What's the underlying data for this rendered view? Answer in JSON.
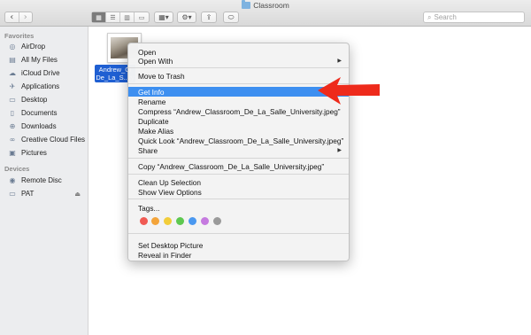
{
  "window": {
    "title": "Classroom"
  },
  "toolbar": {
    "back_glyph": "‹",
    "forward_glyph": "›",
    "view_modes": [
      {
        "icon": "icon-view-grid",
        "glyph": "▦",
        "active": true
      },
      {
        "icon": "list-view-icon",
        "glyph": "☰",
        "active": false
      },
      {
        "icon": "column-view-icon",
        "glyph": "▥",
        "active": false
      },
      {
        "icon": "cover-flow-icon",
        "glyph": "▭",
        "active": false
      }
    ],
    "arrange_glyph": "▦▾",
    "action_glyph": "⚙▾",
    "share_glyph": "⇪",
    "tags_glyph": "⬭",
    "search": {
      "placeholder": "Search",
      "icon": "search-icon"
    }
  },
  "sidebar": {
    "favorites_header": "Favorites",
    "favorites": [
      {
        "label": "AirDrop",
        "icon": "airdrop-icon",
        "glyph": "◎"
      },
      {
        "label": "All My Files",
        "icon": "all-files-icon",
        "glyph": "▤"
      },
      {
        "label": "iCloud Drive",
        "icon": "cloud-icon",
        "glyph": "☁"
      },
      {
        "label": "Applications",
        "icon": "applications-icon",
        "glyph": "✈"
      },
      {
        "label": "Desktop",
        "icon": "desktop-icon",
        "glyph": "▭"
      },
      {
        "label": "Documents",
        "icon": "documents-icon",
        "glyph": "▯"
      },
      {
        "label": "Downloads",
        "icon": "downloads-icon",
        "glyph": "⊕"
      },
      {
        "label": "Creative Cloud Files",
        "icon": "creative-cloud-icon",
        "glyph": "∞"
      },
      {
        "label": "Pictures",
        "icon": "pictures-icon",
        "glyph": "▣"
      }
    ],
    "devices_header": "Devices",
    "devices": [
      {
        "label": "Remote Disc",
        "icon": "disc-icon",
        "glyph": "◉"
      },
      {
        "label": "PAT",
        "icon": "drive-icon",
        "glyph": "▭",
        "eject": "⏏"
      }
    ]
  },
  "file": {
    "label_line1": "Andrew_Cl",
    "label_line2": "De_La_S...ty"
  },
  "context_menu": {
    "items": [
      {
        "label": "Open"
      },
      {
        "label": "Open With",
        "submenu": "▶"
      },
      {
        "label": "Move to Trash"
      },
      {
        "label": "Get Info",
        "highlighted": true
      },
      {
        "label": "Rename"
      },
      {
        "label": "Compress “Andrew_Classroom_De_La_Salle_University.jpeg”"
      },
      {
        "label": "Duplicate"
      },
      {
        "label": "Make Alias"
      },
      {
        "label": "Quick Look “Andrew_Classroom_De_La_Salle_University.jpeg”"
      },
      {
        "label": "Share",
        "submenu": "▶"
      },
      {
        "label": "Copy “Andrew_Classroom_De_La_Salle_University.jpeg”"
      },
      {
        "label": "Clean Up Selection"
      },
      {
        "label": "Show View Options"
      },
      {
        "label": "Tags..."
      },
      {
        "label": "Set Desktop Picture"
      },
      {
        "label": "Reveal in Finder"
      }
    ],
    "tag_colors": [
      "#f05a53",
      "#f3a43a",
      "#f2cd3a",
      "#5ec850",
      "#4a98f0",
      "#c57adf",
      "#9a9a9a"
    ]
  },
  "annotation": {
    "arrow_color": "#ee2a1b"
  }
}
